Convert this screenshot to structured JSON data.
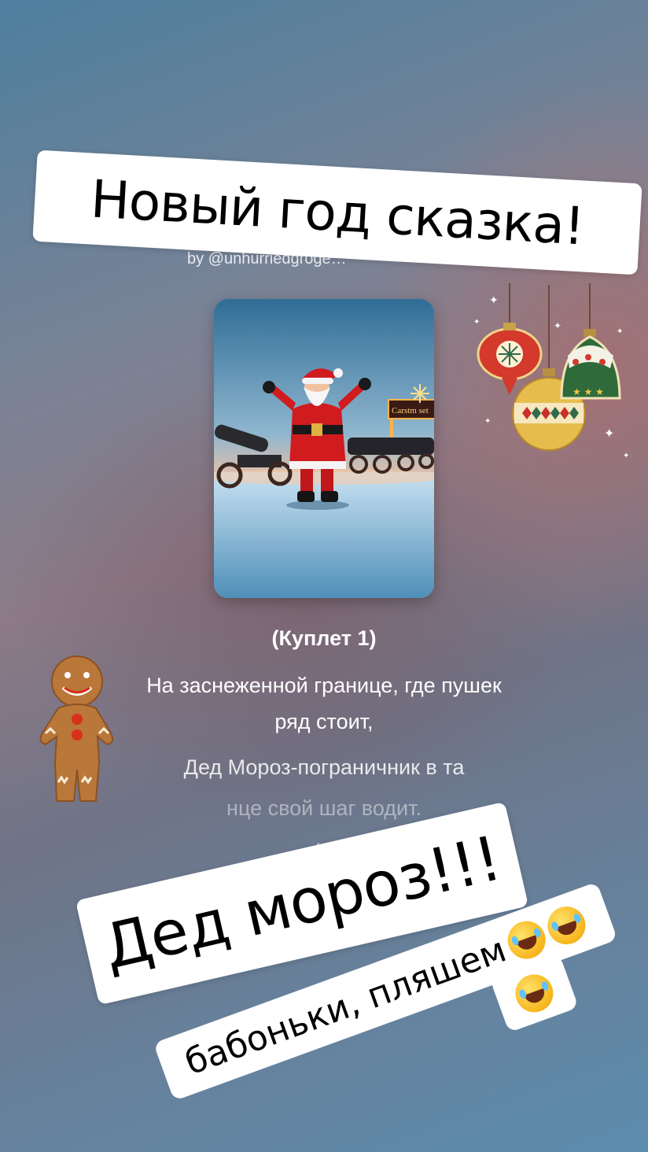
{
  "stickers": {
    "title": "Новый год сказка!",
    "ded_moroz": "Дед мороз!!!",
    "babonki": "бабоньки, пляшем"
  },
  "song": {
    "byline": "by @unhurriedgroge…"
  },
  "lyrics": {
    "heading": "(Куплет 1)",
    "line1": "На заснеженной границе, где пушек ряд стоит,",
    "line2": "Дед Мороз-пограничник в та",
    "line3": "нце свой шаг водит.",
    "line4": "М"
  },
  "cover_sign": "Carstm set",
  "icons": [
    "laughing-emoji-icon",
    "ornaments-icon",
    "gingerbread-icon"
  ]
}
